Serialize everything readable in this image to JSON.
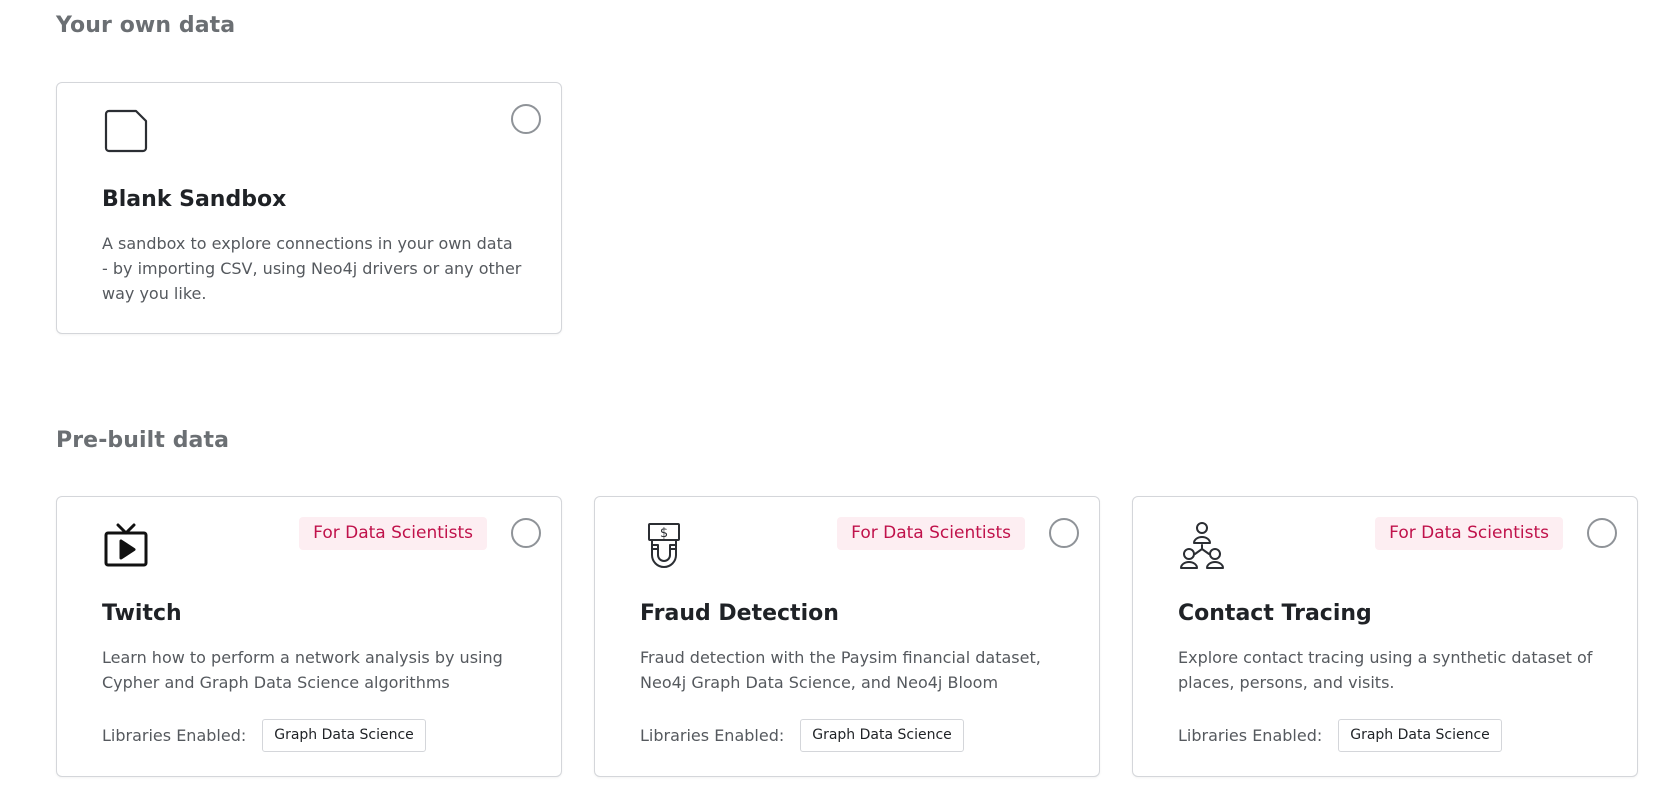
{
  "sections": {
    "own": {
      "title": "Your own data"
    },
    "prebuilt": {
      "title": "Pre-built data"
    }
  },
  "own_cards": [
    {
      "icon": "document-icon",
      "title": "Blank Sandbox",
      "description": "A sandbox to explore connections in your own data - by importing CSV, using Neo4j drivers or any other way you like.",
      "selected": false
    }
  ],
  "prebuilt_cards": [
    {
      "icon": "tv-play-icon",
      "badge": "For Data Scientists",
      "title": "Twitch",
      "description": "Learn how to perform a network analysis by using Cypher and Graph Data Science algorithms",
      "libraries_label": "Libraries Enabled:",
      "libraries": [
        "Graph Data Science"
      ],
      "selected": false
    },
    {
      "icon": "dollar-magnet-icon",
      "badge": "For Data Scientists",
      "title": "Fraud Detection",
      "description": "Fraud detection with the Paysim financial dataset, Neo4j Graph Data Science, and Neo4j Bloom",
      "libraries_label": "Libraries Enabled:",
      "libraries": [
        "Graph Data Science"
      ],
      "selected": false
    },
    {
      "icon": "people-network-icon",
      "badge": "For Data Scientists",
      "title": "Contact Tracing",
      "description": "Explore contact tracing using a synthetic dataset of places, persons, and visits.",
      "libraries_label": "Libraries Enabled:",
      "libraries": [
        "Graph Data Science"
      ],
      "selected": false
    }
  ],
  "colors": {
    "badge_text": "#c0124b",
    "badge_bg": "#fdeef2",
    "section_title": "#6b6f73",
    "card_border": "#d4d6da"
  }
}
